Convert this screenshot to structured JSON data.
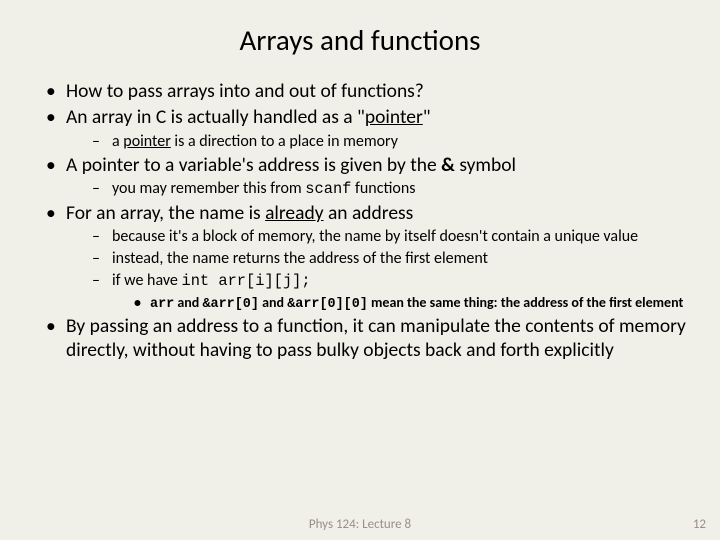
{
  "title": "Arrays and functions",
  "bullets": {
    "b1": "How to pass arrays into and out of functions?",
    "b2_pre": "An array in C is actually handled as a \"",
    "b2_u": "pointer",
    "b2_post": "\"",
    "b2_1_pre": "a ",
    "b2_1_u": "pointer",
    "b2_1_post": " is a direction to a place in memory",
    "b3_pre": "A pointer to a variable's address is given by the ",
    "b3_b": "&",
    "b3_post": " symbol",
    "b3_1_pre": "you may remember this from ",
    "b3_1_code": "scanf",
    "b3_1_post": " functions",
    "b4_pre": "For an array, the name is ",
    "b4_u": "already",
    "b4_post": " an address",
    "b4_1": "because it's a block of memory, the name by itself doesn't contain a unique value",
    "b4_2": "instead, the name returns the address of the first element",
    "b4_3_pre": "if we have ",
    "b4_3_code": "int arr[i][j];",
    "b4_3a_c1": "arr",
    "b4_3a_t1": " and ",
    "b4_3a_c2": "&arr[0]",
    "b4_3a_t2": " and ",
    "b4_3a_c3": "&arr[0][0]",
    "b4_3a_t3": "  mean the same thing: the address of the first element",
    "b5": "By passing an address to a function, it can manipulate the contents of memory directly, without having to pass bulky objects back and forth explicitly"
  },
  "footer": {
    "center": "Phys 124: Lecture 8",
    "page": "12"
  }
}
